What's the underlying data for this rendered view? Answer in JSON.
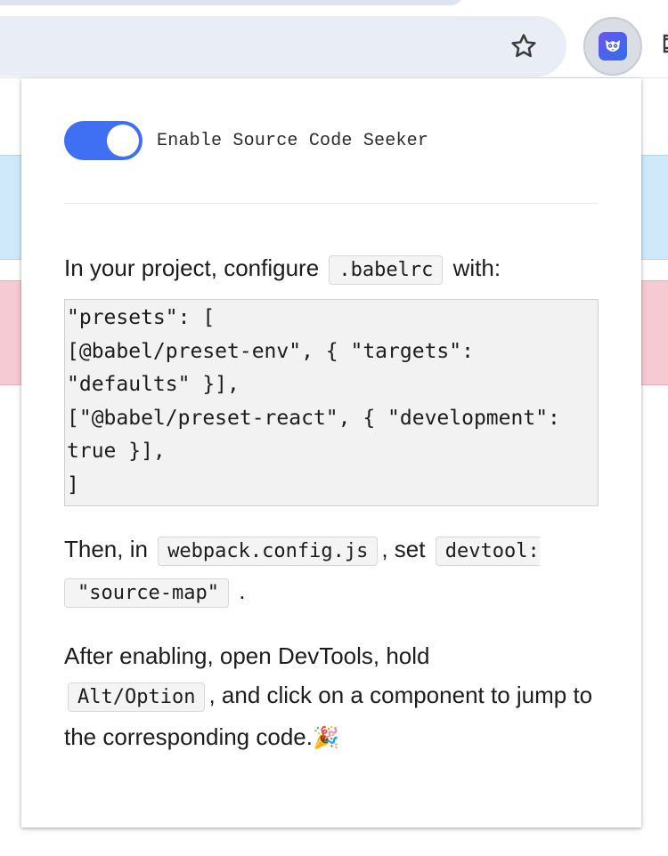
{
  "toolbar": {
    "bookmark_icon": "star-outline-icon",
    "extension_icon": "owl-extension-icon",
    "extensions_menu_icon": "puzzle-icon"
  },
  "popup": {
    "toggle": {
      "label": "Enable Source Code Seeker",
      "enabled": true,
      "color": "#3f6ff3"
    },
    "step1": {
      "prefix": "In your project, configure",
      "code": ".babelrc",
      "suffix": "with:"
    },
    "code_block": {
      "lines": [
        "\"presets\": [",
        "[@babel/preset-env\", { \"targets\":",
        "\"defaults\" }],",
        "[\"@babel/preset-react\", { \"development\":",
        "true }],",
        "]"
      ]
    },
    "step2": {
      "prefix": "Then, in",
      "code1": "webpack.config.js",
      "middle": ", set",
      "code2_part1": "devtool:",
      "code2_part2": "\"source-map\"",
      "suffix": "."
    },
    "step3": {
      "prefix": "After enabling, open DevTools, hold",
      "code": "Alt/Option",
      "suffix": ", and click on a component to jump to the corresponding code.",
      "emoji": "🎉"
    }
  },
  "colors": {
    "background_band_blue": "#cfe9fb",
    "background_band_pink": "#f6cad2"
  }
}
